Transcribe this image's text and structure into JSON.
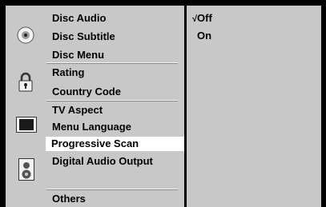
{
  "menu": {
    "disc_group": [
      "Disc Audio",
      "Disc Subtitle",
      "Disc Menu"
    ],
    "lock_group": [
      "Rating",
      "Country Code"
    ],
    "display_group": [
      "TV Aspect",
      "Menu Language"
    ],
    "selected_item": "Progressive Scan",
    "audio_group": [
      "Digital Audio Output"
    ],
    "others_group": [
      "Others"
    ]
  },
  "options": {
    "check_mark": "√",
    "items": [
      "Off",
      "On"
    ],
    "checked": "Off"
  },
  "icons": {
    "disc": "disc-icon",
    "lock": "padlock-icon",
    "display": "tv-screen-icon",
    "audio": "speaker-icon"
  },
  "colors": {
    "panel": "#c8c8c8",
    "highlight": "#ffffff",
    "frame": "#000000"
  }
}
